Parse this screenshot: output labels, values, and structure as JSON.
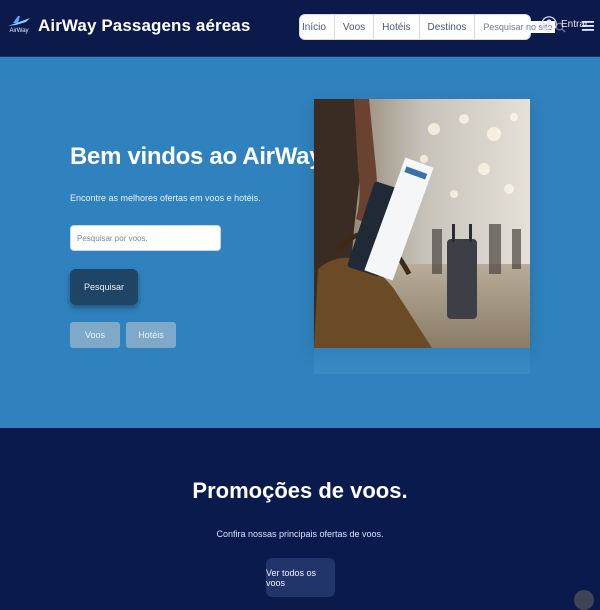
{
  "header": {
    "brand": "AirWay Passagens aéreas",
    "logo_text": "AirWay",
    "nav": [
      "Início",
      "Voos",
      "Hotéis",
      "Destinos"
    ],
    "search_placeholder": "Pesquisar no site",
    "login_label": "Entrar"
  },
  "hero": {
    "title": "Bem vindos ao AirWay!",
    "subtitle": "Encontre as melhores ofertas em voos e hotéis.",
    "input_placeholder": "Pesquisar por voos.",
    "search_button": "Pesquisar",
    "chips": [
      "Voos",
      "Hotéis"
    ],
    "background": "#2f82bd"
  },
  "promo": {
    "title": "Promoções de voos.",
    "subtitle": "Confira nossas principais ofertas de voos.",
    "button": "Ver todos os voos",
    "background": "#0a1a4c"
  },
  "icons": {
    "logo": "airplane-logo-icon",
    "search": "search-icon",
    "user": "user-icon",
    "menu": "hamburger-menu-icon"
  }
}
